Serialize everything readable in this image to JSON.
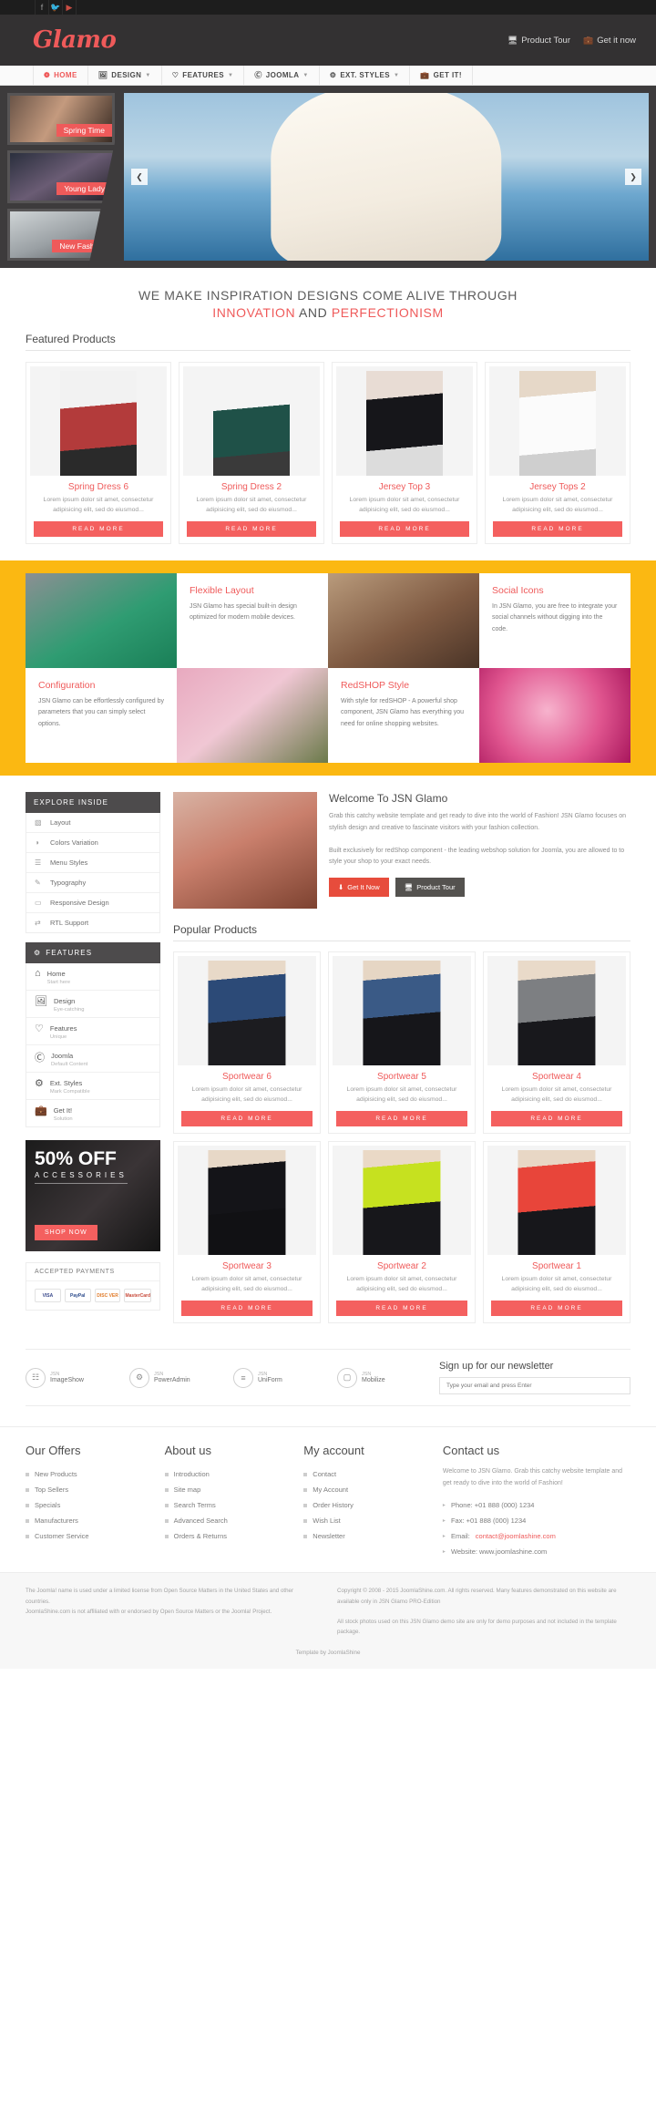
{
  "topbar": {
    "social": [
      {
        "name": "facebook-icon",
        "glyph": "f"
      },
      {
        "name": "twitter-icon",
        "glyph": "ᴛ"
      },
      {
        "name": "youtube-icon",
        "glyph": "▶"
      }
    ]
  },
  "header": {
    "logo": "Glamo",
    "links": [
      {
        "label": "Product Tour",
        "icon": "⬜"
      },
      {
        "label": "Get it now",
        "icon": "Ὃc"
      }
    ]
  },
  "menu": [
    {
      "label": "HOME",
      "icon": "✹",
      "caret": false,
      "active": true
    },
    {
      "label": "DESIGN",
      "icon": "⬚",
      "caret": true,
      "active": false
    },
    {
      "label": "FEATURES",
      "icon": "♡",
      "caret": true,
      "active": false
    },
    {
      "label": "JOOMLA",
      "icon": "Ⓐ",
      "caret": true,
      "active": false
    },
    {
      "label": "EXT. STYLES",
      "icon": "⚙",
      "caret": true,
      "active": false
    },
    {
      "label": "GET IT!",
      "icon": "▬",
      "caret": false,
      "active": false
    }
  ],
  "slider": {
    "thumbs": [
      {
        "label": "Spring Time",
        "cls": "t1"
      },
      {
        "label": "Young Lady",
        "cls": "t2"
      },
      {
        "label": "New Fashion",
        "cls": "t3"
      }
    ],
    "prev": "❮",
    "next": "❯"
  },
  "tagline": {
    "line1": "WE MAKE INSPIRATION DESIGNS COME ALIVE THROUGH",
    "hi1": "INNOVATION",
    "mid": " AND ",
    "hi2": "PERFECTIONISM"
  },
  "featured": {
    "title": "Featured Products",
    "read_more": "READ MORE",
    "items": [
      {
        "name": "Spring Dress 6",
        "desc": "Lorem ipsum dolor sit amet, consectetur adipisicing elit, sed do eiusmod..."
      },
      {
        "name": "Spring Dress 2",
        "desc": "Lorem ipsum dolor sit amet, consectetur adipisicing elit, sed do eiusmod..."
      },
      {
        "name": "Jersey Top 3",
        "desc": "Lorem ipsum dolor sit amet, consectetur adipisicing elit, sed do eiusmod..."
      },
      {
        "name": "Jersey Tops 2",
        "desc": "Lorem ipsum dolor sit amet, consectetur adipisicing elit, sed do eiusmod..."
      }
    ]
  },
  "features_band": {
    "row1": [
      {
        "type": "img",
        "cls": "i-green"
      },
      {
        "type": "box",
        "title": "Flexible Layout",
        "text": "JSN Glamo has special built-in design optimized for modern mobile devices."
      },
      {
        "type": "img",
        "cls": "i-red"
      },
      {
        "type": "box",
        "title": "Social Icons",
        "text": "In JSN Glamo, you are free to integrate your social channels without digging into the code."
      }
    ],
    "row2": [
      {
        "type": "box",
        "title": "Configuration",
        "text": "JSN Glamo can be effortlessly configured by parameters that you can simply select options."
      },
      {
        "type": "img",
        "cls": "i-blos"
      },
      {
        "type": "box",
        "title": "RedSHOP Style",
        "text": "With style for redSHOP - A powerful shop component, JSN Glamo has everything you need for online shopping websites."
      },
      {
        "type": "img",
        "cls": "i-pink"
      }
    ]
  },
  "sidebar": {
    "explore_title": "EXPLORE INSIDE",
    "explore_items": [
      {
        "label": "Layout",
        "icon": "▧"
      },
      {
        "label": "Colors Variation",
        "icon": "◑"
      },
      {
        "label": "Menu Styles",
        "icon": "☰"
      },
      {
        "label": "Typography",
        "icon": "✒"
      },
      {
        "label": "Responsive Design",
        "icon": "▭"
      },
      {
        "label": "RTL Support",
        "icon": "⇄"
      }
    ],
    "features_title": "FEATURES",
    "features_icon": "⚙",
    "features_items": [
      {
        "label": "Home",
        "sub": "Start here",
        "icon": "⌂"
      },
      {
        "label": "Design",
        "sub": "Eye-catching",
        "icon": "⬚"
      },
      {
        "label": "Features",
        "sub": "Unique",
        "icon": "♡"
      },
      {
        "label": "Joomla",
        "sub": "Default Content",
        "icon": "Ⓐ"
      },
      {
        "label": "Ext. Styles",
        "sub": "Mark Compatible",
        "icon": "⚙"
      },
      {
        "label": "Get It!",
        "sub": "Solution",
        "icon": "▬"
      }
    ],
    "promo": {
      "big": "50% OFF",
      "small": "ACCESSORIES",
      "button": "SHOP NOW"
    },
    "payments": {
      "title": "ACCEPTED PAYMENTS",
      "cards": [
        "VISA",
        "PayPal",
        "DISC VER",
        "MasterCard"
      ]
    }
  },
  "welcome": {
    "title": "Welcome To JSN Glamo",
    "text": "Grab this catchy website template and get ready to dive into the world of Fashion! JSN Glamo focuses on stylish design and creative to fascinate visitors with your fashion collection.\n\nBuilt exclusively for redShop component - the leading webshop solution for Joomla, you are allowed to to style your shop to your exact needs.",
    "btn1": "Get It Now",
    "btn2": "Product Tour",
    "btn1_icon": "⬇",
    "btn2_icon": "⬜"
  },
  "popular": {
    "title": "Popular Products",
    "read_more": "READ MORE",
    "row1": [
      {
        "name": "Sportwear 6",
        "desc": "Lorem ipsum dolor sit amet, consectetur adipisicing elit, sed do eiusmod..."
      },
      {
        "name": "Sportwear 5",
        "desc": "Lorem ipsum dolor sit amet, consectetur adipisicing elit, sed do eiusmod..."
      },
      {
        "name": "Sportwear 4",
        "desc": "Lorem ipsum dolor sit amet, consectetur adipisicing elit, sed do eiusmod..."
      }
    ],
    "row2": [
      {
        "name": "Sportwear 3",
        "desc": "Lorem ipsum dolor sit amet, consectetur adipisicing elit, sed do eiusmod..."
      },
      {
        "name": "Sportwear 2",
        "desc": "Lorem ipsum dolor sit amet, consectetur adipisicing elit, sed do eiusmod..."
      },
      {
        "name": "Sportwear 1",
        "desc": "Lorem ipsum dolor sit amet, consectetur adipisicing elit, sed do eiusmod..."
      }
    ]
  },
  "extensions": [
    {
      "brand": "JSN",
      "name": "ImageShow",
      "icon": "☷"
    },
    {
      "brand": "JSN",
      "name": "PowerAdmin",
      "icon": "⚙"
    },
    {
      "brand": "JSN",
      "name": "UniForm",
      "icon": "≡"
    },
    {
      "brand": "JSN",
      "name": "Mobilize",
      "icon": "▢"
    }
  ],
  "newsletter": {
    "title": "Sign up for our newsletter",
    "placeholder": "Type your email and press Enter"
  },
  "footer": {
    "columns": [
      {
        "title": "Our Offers",
        "links": [
          "New Products",
          "Top Sellers",
          "Specials",
          "Manufacturers",
          "Customer Service"
        ]
      },
      {
        "title": "About us",
        "links": [
          "Introduction",
          "Site map",
          "Search Terms",
          "Advanced Search",
          "Orders & Returns"
        ]
      },
      {
        "title": "My account",
        "links": [
          "Contact",
          "My Account",
          "Order History",
          "Wish List",
          "Newsletter"
        ]
      }
    ],
    "contact": {
      "title": "Contact us",
      "desc": "Welcome to JSN Glamo. Grab this catchy website template and get ready to dive into the world of Fashion!",
      "items": [
        {
          "label": "Phone: +01 888 (000) 1234",
          "link": ""
        },
        {
          "label": "Fax: +01 888 (000) 1234",
          "link": ""
        },
        {
          "label": "Email: ",
          "link": "contact@joomlashine.com"
        },
        {
          "label": "Website: www.joomlashine.com",
          "link": ""
        }
      ]
    }
  },
  "copyright": {
    "left": "The Joomla! name is used under a limited license from Open Source Matters in the United States and other countries.\nJoomlaShine.com is not affiliated with or endorsed by Open Source Matters or the Joomla! Project.",
    "right": "Copyright © 2008 - 2015 JoomlaShine.com. All rights reserved. Many features demonstrated on this website are available only in JSN Glamo PRO-Edition\n\nAll stock photos used on this JSN Glamo demo site are only for demo purposes and not included in the template package.",
    "byline": "Template by JoomlaShine"
  },
  "colors": {
    "accent": "#ef5a5a",
    "yellow": "#fbb812",
    "dark": "#333132"
  }
}
